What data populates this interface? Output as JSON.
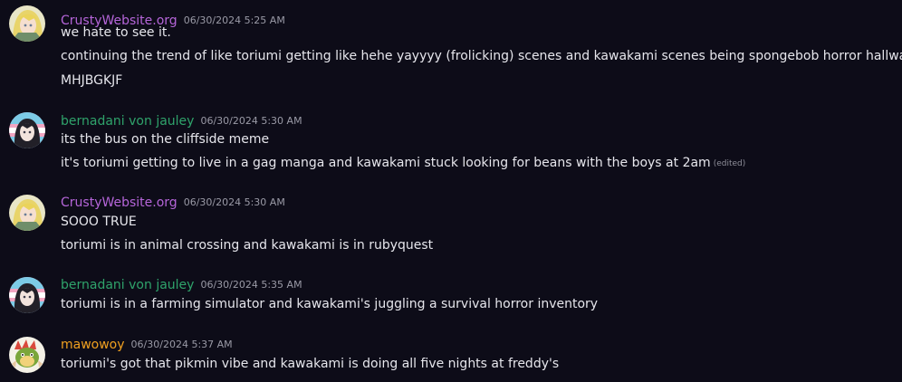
{
  "colors": {
    "background": "#0d0c18",
    "crusty": "#b565d9",
    "bernadani": "#2fa36b",
    "mawowoy": "#f0a020",
    "timestamp": "#9a9aa6"
  },
  "messages": [
    {
      "author": "CrustyWebsite.org",
      "timestamp": "06/30/2024 5:25 AM",
      "avatar_icon": "blonde-anime-avatar-icon",
      "lines": [
        "we hate to see it.",
        "continuing the trend of like toriumi getting like hehe yayyyy (frolicking) scenes and kawakami scenes being spongebob horror hallway",
        "MHJBGKJF"
      ]
    },
    {
      "author": "bernadani von jauley",
      "timestamp": "06/30/2024 5:30 AM",
      "avatar_icon": "dark-haired-anime-avatar-icon",
      "lines": [
        "its the bus on the cliffside meme",
        "it's toriumi getting to live in a gag manga and kawakami stuck looking for beans with the boys at 2am"
      ],
      "edited_label": "(edited)"
    },
    {
      "author": "CrustyWebsite.org",
      "timestamp": "06/30/2024 5:30 AM",
      "avatar_icon": "blonde-anime-avatar-icon",
      "lines": [
        "SOOO TRUE",
        "toriumi is in animal crossing and kawakami is in rubyquest"
      ]
    },
    {
      "author": "bernadani von jauley",
      "timestamp": "06/30/2024 5:35 AM",
      "avatar_icon": "dark-haired-anime-avatar-icon",
      "lines": [
        "toriumi is in a farming simulator and kawakami's juggling a survival horror inventory"
      ]
    },
    {
      "author": "mawowoy",
      "timestamp": "06/30/2024 5:37 AM",
      "avatar_icon": "bowser-avatar-icon",
      "lines": [
        "toriumi's got that pikmin vibe and kawakami is doing all five nights at freddy's"
      ]
    }
  ]
}
